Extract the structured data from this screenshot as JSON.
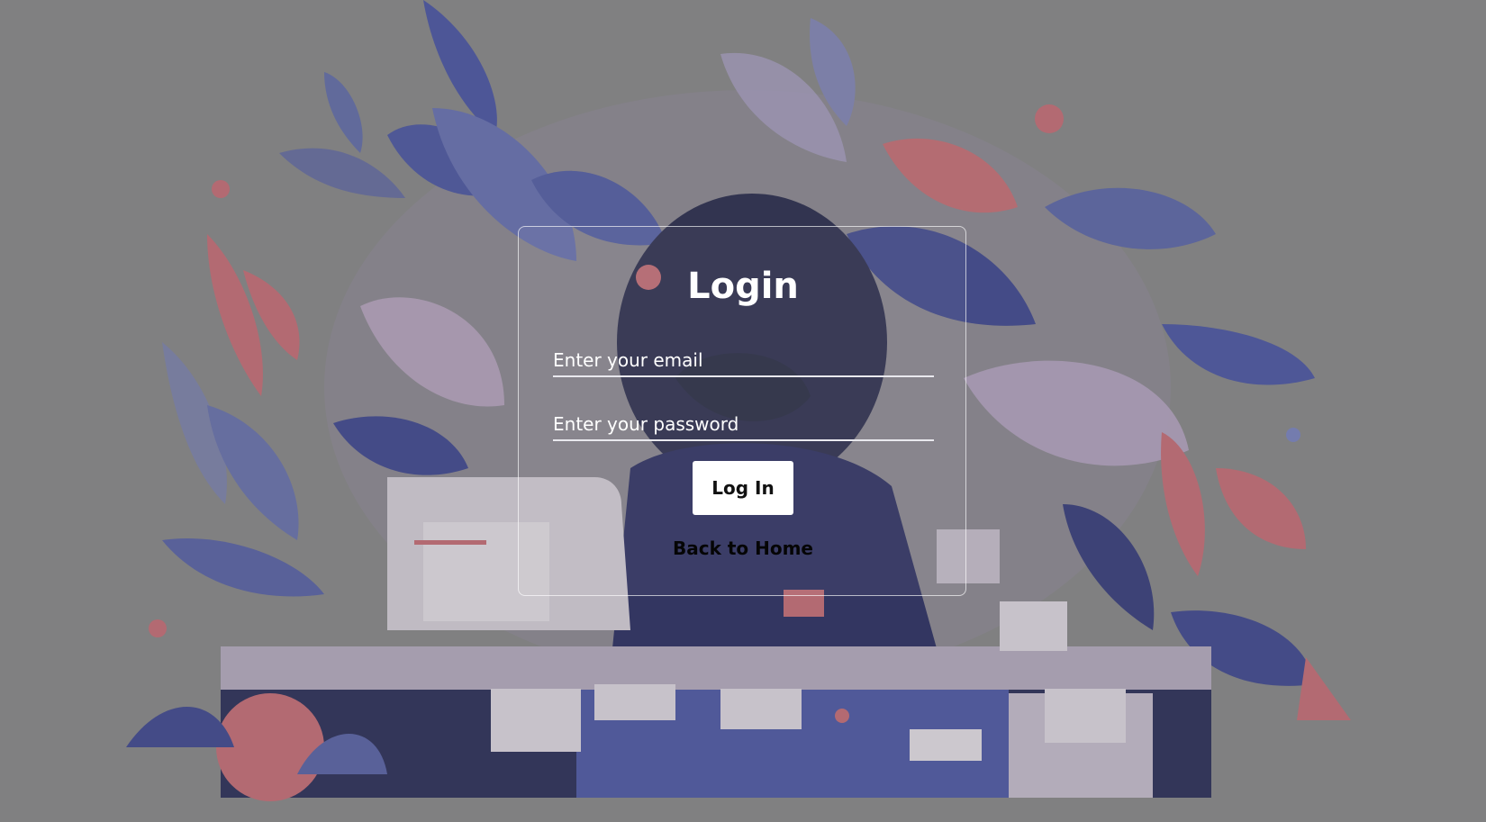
{
  "login": {
    "title": "Login",
    "email_placeholder": "Enter your email",
    "password_placeholder": "Enter your password",
    "submit_label": "Log In",
    "back_link": "Back to Home"
  },
  "colors": {
    "overlay": "#7f7f80",
    "navy": "#1f2560",
    "indigo": "#4b57a8",
    "coral": "#c9606a",
    "pink": "#c9a6b8",
    "paper": "#e7e2ea",
    "white": "#ffffff"
  }
}
